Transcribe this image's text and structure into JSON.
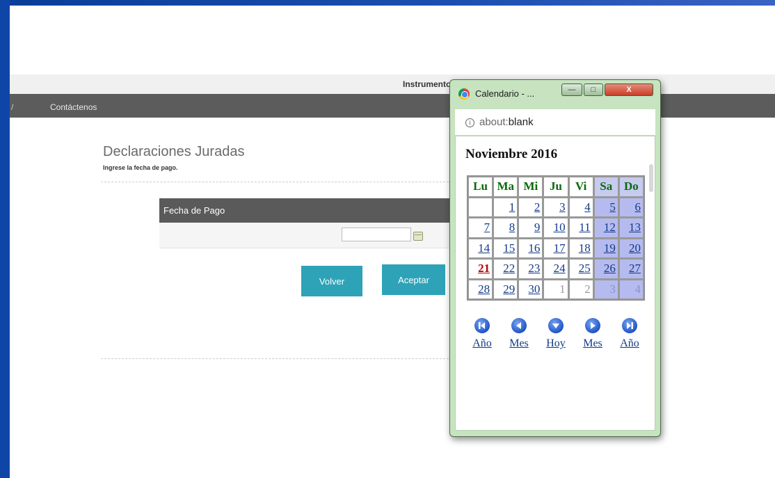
{
  "page": {
    "site_title": "Instrumentos Privados",
    "nav_link": "Contáctenos",
    "heading": "Declaraciones Juradas",
    "subheading": "Ingrese la fecha de pago.",
    "panel_title": "Fecha de Pago",
    "date_value": "",
    "btn_back": "Volver",
    "btn_ok": "Aceptar"
  },
  "popup": {
    "window_title": "Calendario - ...",
    "address_scheme": "about:",
    "address_path": "blank",
    "month_title": "Noviembre 2016",
    "day_headers": [
      "Lu",
      "Ma",
      "Mi",
      "Ju",
      "Vi",
      "Sa",
      "Do"
    ],
    "weeks": [
      [
        "",
        "1",
        "2",
        "3",
        "4",
        "5",
        "6"
      ],
      [
        "7",
        "8",
        "9",
        "10",
        "11",
        "12",
        "13"
      ],
      [
        "14",
        "15",
        "16",
        "17",
        "18",
        "19",
        "20"
      ],
      [
        "21",
        "22",
        "23",
        "24",
        "25",
        "26",
        "27"
      ],
      [
        "28",
        "29",
        "30",
        "1",
        "2",
        "3",
        "4"
      ]
    ],
    "today": "21",
    "nav": [
      {
        "label": "Año",
        "icon": "skip-back-icon"
      },
      {
        "label": "Mes",
        "icon": "arrow-left-icon"
      },
      {
        "label": "Hoy",
        "icon": "arrow-down-icon"
      },
      {
        "label": "Mes",
        "icon": "arrow-right-icon"
      },
      {
        "label": "Año",
        "icon": "skip-forward-icon"
      }
    ]
  },
  "colors": {
    "accent_button": "#2ea3b8",
    "nav_bar": "#5c5c5c",
    "weekend_cell": "#b6bbef",
    "popup_frame": "#c7e3c0"
  }
}
